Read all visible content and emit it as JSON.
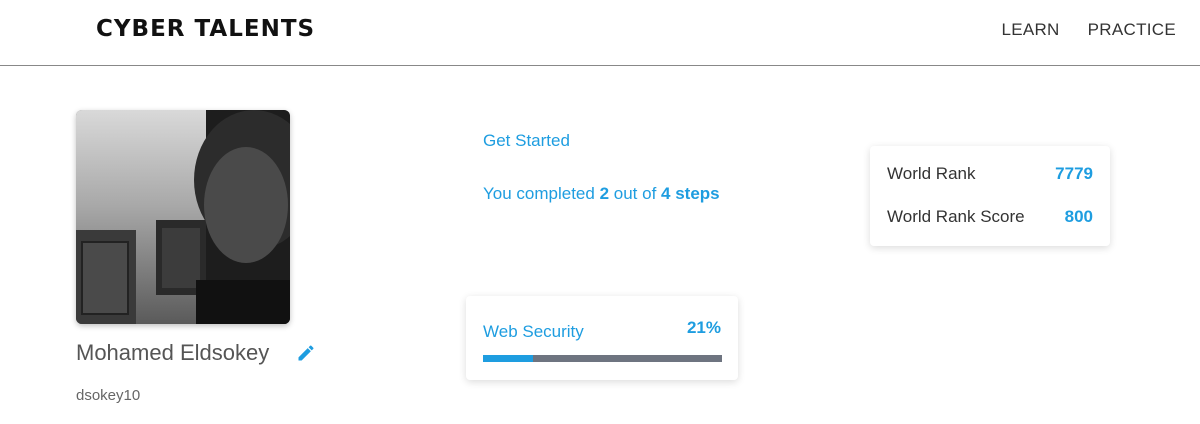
{
  "header": {
    "logo": "CYBER TALENTS",
    "nav": [
      {
        "label": "LEARN"
      },
      {
        "label": "PRACTICE"
      }
    ]
  },
  "profile": {
    "name": "Mohamed Eldsokey",
    "username": "dsokey10",
    "avatar_icon": "user-photo",
    "edit_icon": "pencil-icon"
  },
  "get_started": {
    "title": "Get Started",
    "prefix": "You completed ",
    "completed": "2",
    "middle": " out of ",
    "total": "4 steps"
  },
  "rank": {
    "world_rank_label": "World Rank",
    "world_rank_value": "7779",
    "score_label": "World Rank Score",
    "score_value": "800"
  },
  "skill": {
    "name": "Web Security",
    "percent_label": "21%",
    "progress": 0.21
  },
  "colors": {
    "accent": "#1e9de0",
    "track": "#6e7480"
  }
}
